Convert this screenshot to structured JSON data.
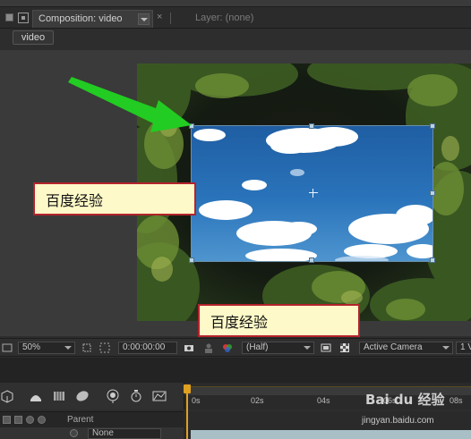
{
  "tabbar": {
    "comp_tab_label": "Composition: video",
    "close_glyph": "×",
    "layer_tab_label": "Layer: (none)"
  },
  "comp_chip": "video",
  "annotations": {
    "label_1": "百度经验",
    "label_2": "百度经验",
    "arrow_color": "#22cc22",
    "border_color": "#b3232c"
  },
  "viewer_bar": {
    "zoom": "50%",
    "timecode": "0:00:00:00",
    "resolution": "(Half)",
    "view": "Active Camera",
    "views_count": "1 V"
  },
  "timeline": {
    "ruler_ticks": [
      "0s",
      "02s",
      "04s",
      "06s",
      "08s"
    ],
    "parent_header": "Parent",
    "parent_value": "None"
  },
  "watermark": {
    "text": "Bai du 经验",
    "url": "jingyan.baidu.com"
  },
  "icons": [
    "lock-icon",
    "composition-icon",
    "snapshot-icon",
    "channel-icon",
    "grid-icon",
    "transparency-icon",
    "playhead-icon"
  ]
}
